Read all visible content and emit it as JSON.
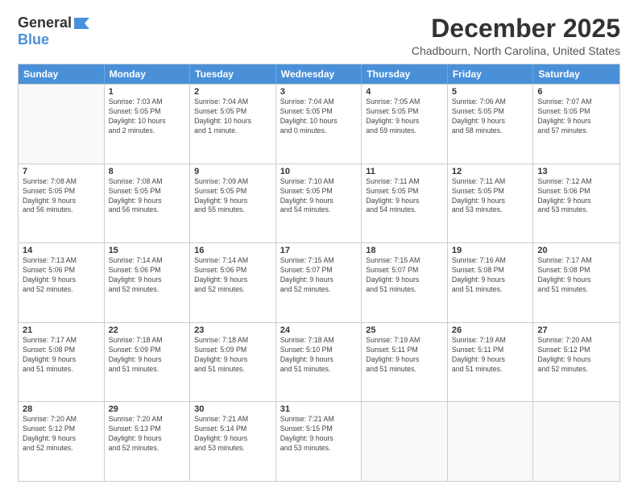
{
  "header": {
    "logo_general": "General",
    "logo_blue": "Blue",
    "month_title": "December 2025",
    "location": "Chadbourn, North Carolina, United States"
  },
  "calendar": {
    "days_of_week": [
      "Sunday",
      "Monday",
      "Tuesday",
      "Wednesday",
      "Thursday",
      "Friday",
      "Saturday"
    ],
    "rows": [
      [
        {
          "day": "",
          "lines": []
        },
        {
          "day": "1",
          "lines": [
            "Sunrise: 7:03 AM",
            "Sunset: 5:05 PM",
            "Daylight: 10 hours",
            "and 2 minutes."
          ]
        },
        {
          "day": "2",
          "lines": [
            "Sunrise: 7:04 AM",
            "Sunset: 5:05 PM",
            "Daylight: 10 hours",
            "and 1 minute."
          ]
        },
        {
          "day": "3",
          "lines": [
            "Sunrise: 7:04 AM",
            "Sunset: 5:05 PM",
            "Daylight: 10 hours",
            "and 0 minutes."
          ]
        },
        {
          "day": "4",
          "lines": [
            "Sunrise: 7:05 AM",
            "Sunset: 5:05 PM",
            "Daylight: 9 hours",
            "and 59 minutes."
          ]
        },
        {
          "day": "5",
          "lines": [
            "Sunrise: 7:06 AM",
            "Sunset: 5:05 PM",
            "Daylight: 9 hours",
            "and 58 minutes."
          ]
        },
        {
          "day": "6",
          "lines": [
            "Sunrise: 7:07 AM",
            "Sunset: 5:05 PM",
            "Daylight: 9 hours",
            "and 57 minutes."
          ]
        }
      ],
      [
        {
          "day": "7",
          "lines": [
            "Sunrise: 7:08 AM",
            "Sunset: 5:05 PM",
            "Daylight: 9 hours",
            "and 56 minutes."
          ]
        },
        {
          "day": "8",
          "lines": [
            "Sunrise: 7:08 AM",
            "Sunset: 5:05 PM",
            "Daylight: 9 hours",
            "and 56 minutes."
          ]
        },
        {
          "day": "9",
          "lines": [
            "Sunrise: 7:09 AM",
            "Sunset: 5:05 PM",
            "Daylight: 9 hours",
            "and 55 minutes."
          ]
        },
        {
          "day": "10",
          "lines": [
            "Sunrise: 7:10 AM",
            "Sunset: 5:05 PM",
            "Daylight: 9 hours",
            "and 54 minutes."
          ]
        },
        {
          "day": "11",
          "lines": [
            "Sunrise: 7:11 AM",
            "Sunset: 5:05 PM",
            "Daylight: 9 hours",
            "and 54 minutes."
          ]
        },
        {
          "day": "12",
          "lines": [
            "Sunrise: 7:11 AM",
            "Sunset: 5:05 PM",
            "Daylight: 9 hours",
            "and 53 minutes."
          ]
        },
        {
          "day": "13",
          "lines": [
            "Sunrise: 7:12 AM",
            "Sunset: 5:06 PM",
            "Daylight: 9 hours",
            "and 53 minutes."
          ]
        }
      ],
      [
        {
          "day": "14",
          "lines": [
            "Sunrise: 7:13 AM",
            "Sunset: 5:06 PM",
            "Daylight: 9 hours",
            "and 52 minutes."
          ]
        },
        {
          "day": "15",
          "lines": [
            "Sunrise: 7:14 AM",
            "Sunset: 5:06 PM",
            "Daylight: 9 hours",
            "and 52 minutes."
          ]
        },
        {
          "day": "16",
          "lines": [
            "Sunrise: 7:14 AM",
            "Sunset: 5:06 PM",
            "Daylight: 9 hours",
            "and 52 minutes."
          ]
        },
        {
          "day": "17",
          "lines": [
            "Sunrise: 7:15 AM",
            "Sunset: 5:07 PM",
            "Daylight: 9 hours",
            "and 52 minutes."
          ]
        },
        {
          "day": "18",
          "lines": [
            "Sunrise: 7:15 AM",
            "Sunset: 5:07 PM",
            "Daylight: 9 hours",
            "and 51 minutes."
          ]
        },
        {
          "day": "19",
          "lines": [
            "Sunrise: 7:16 AM",
            "Sunset: 5:08 PM",
            "Daylight: 9 hours",
            "and 51 minutes."
          ]
        },
        {
          "day": "20",
          "lines": [
            "Sunrise: 7:17 AM",
            "Sunset: 5:08 PM",
            "Daylight: 9 hours",
            "and 51 minutes."
          ]
        }
      ],
      [
        {
          "day": "21",
          "lines": [
            "Sunrise: 7:17 AM",
            "Sunset: 5:08 PM",
            "Daylight: 9 hours",
            "and 51 minutes."
          ]
        },
        {
          "day": "22",
          "lines": [
            "Sunrise: 7:18 AM",
            "Sunset: 5:09 PM",
            "Daylight: 9 hours",
            "and 51 minutes."
          ]
        },
        {
          "day": "23",
          "lines": [
            "Sunrise: 7:18 AM",
            "Sunset: 5:09 PM",
            "Daylight: 9 hours",
            "and 51 minutes."
          ]
        },
        {
          "day": "24",
          "lines": [
            "Sunrise: 7:18 AM",
            "Sunset: 5:10 PM",
            "Daylight: 9 hours",
            "and 51 minutes."
          ]
        },
        {
          "day": "25",
          "lines": [
            "Sunrise: 7:19 AM",
            "Sunset: 5:11 PM",
            "Daylight: 9 hours",
            "and 51 minutes."
          ]
        },
        {
          "day": "26",
          "lines": [
            "Sunrise: 7:19 AM",
            "Sunset: 5:11 PM",
            "Daylight: 9 hours",
            "and 51 minutes."
          ]
        },
        {
          "day": "27",
          "lines": [
            "Sunrise: 7:20 AM",
            "Sunset: 5:12 PM",
            "Daylight: 9 hours",
            "and 52 minutes."
          ]
        }
      ],
      [
        {
          "day": "28",
          "lines": [
            "Sunrise: 7:20 AM",
            "Sunset: 5:12 PM",
            "Daylight: 9 hours",
            "and 52 minutes."
          ]
        },
        {
          "day": "29",
          "lines": [
            "Sunrise: 7:20 AM",
            "Sunset: 5:13 PM",
            "Daylight: 9 hours",
            "and 52 minutes."
          ]
        },
        {
          "day": "30",
          "lines": [
            "Sunrise: 7:21 AM",
            "Sunset: 5:14 PM",
            "Daylight: 9 hours",
            "and 53 minutes."
          ]
        },
        {
          "day": "31",
          "lines": [
            "Sunrise: 7:21 AM",
            "Sunset: 5:15 PM",
            "Daylight: 9 hours",
            "and 53 minutes."
          ]
        },
        {
          "day": "",
          "lines": []
        },
        {
          "day": "",
          "lines": []
        },
        {
          "day": "",
          "lines": []
        }
      ]
    ]
  }
}
